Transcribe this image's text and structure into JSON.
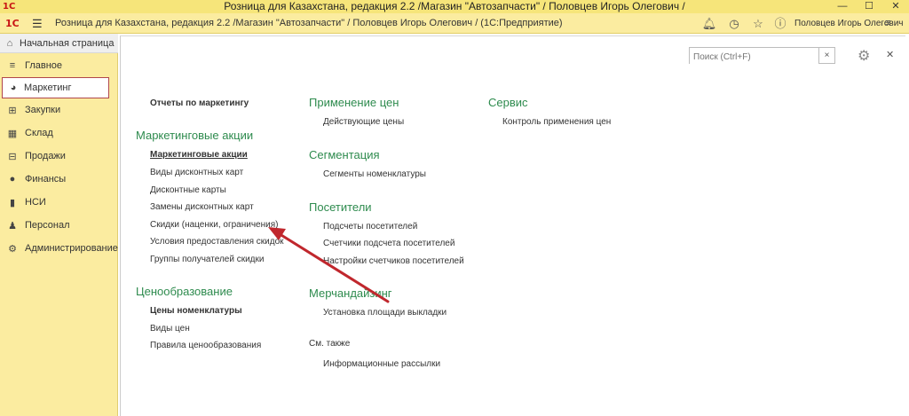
{
  "titlebar": {
    "logo": "1С",
    "title": "Розница для Казахстана, редакция 2.2 /Магазин \"Автозапчасти\" / Половцев Игорь Олегович /",
    "minimize": "—",
    "maximize": "☐",
    "close": "✕"
  },
  "toolbar": {
    "logo": "1С",
    "path": "Розница для Казахстана, редакция 2.2 /Магазин \"Автозапчасти\" / Половцев Игорь Олегович /  (1С:Предприятие)",
    "user": "Половцев Игорь Олегович"
  },
  "sidebar": {
    "home": "Начальная страница",
    "items": [
      {
        "label": "Главное",
        "icon": "≡"
      },
      {
        "label": "Маркетинг",
        "icon": "◕"
      },
      {
        "label": "Закупки",
        "icon": "⊞"
      },
      {
        "label": "Склад",
        "icon": "▦"
      },
      {
        "label": "Продажи",
        "icon": "⊟"
      },
      {
        "label": "Финансы",
        "icon": "●"
      },
      {
        "label": "НСИ",
        "icon": "▮"
      },
      {
        "label": "Персонал",
        "icon": "♟"
      },
      {
        "label": "Администрирование",
        "icon": "⚙"
      }
    ]
  },
  "search": {
    "placeholder": "Поиск (Ctrl+F)",
    "clear": "×"
  },
  "content": {
    "reports": "Отчеты по маркетингу",
    "promo_title": "Маркетинговые акции",
    "promo_links": [
      "Маркетинговые акции",
      "Виды дисконтных карт",
      "Дисконтные карты",
      "Замены дисконтных карт",
      "Скидки (наценки, ограничения)",
      "Условия предоставления скидок",
      "Группы получателей скидки"
    ],
    "pricing_title": "Ценообразование",
    "pricing_links": [
      "Цены номенклатуры",
      "Виды цен",
      "Правила ценообразования"
    ],
    "apply_title": "Применение цен",
    "apply_links": [
      "Действующие цены"
    ],
    "seg_title": "Сегментация",
    "seg_links": [
      "Сегменты номенклатуры"
    ],
    "visitors_title": "Посетители",
    "visitors_links": [
      "Подсчеты посетителей",
      "Счетчики подсчета посетителей",
      "Настройки счетчиков посетителей"
    ],
    "merch_title": "Мерчандайзинг",
    "merch_links": [
      "Установка площади выкладки"
    ],
    "see_also": "См. также",
    "see_also_links": [
      "Информационные рассылки"
    ],
    "service_title": "Сервис",
    "service_links": [
      "Контроль применения цен"
    ]
  },
  "colors": {
    "section": "#2e8b4e",
    "arrow": "#c0272d",
    "active_border": "#b0464b",
    "sidebar_bg": "#fbeca0"
  }
}
